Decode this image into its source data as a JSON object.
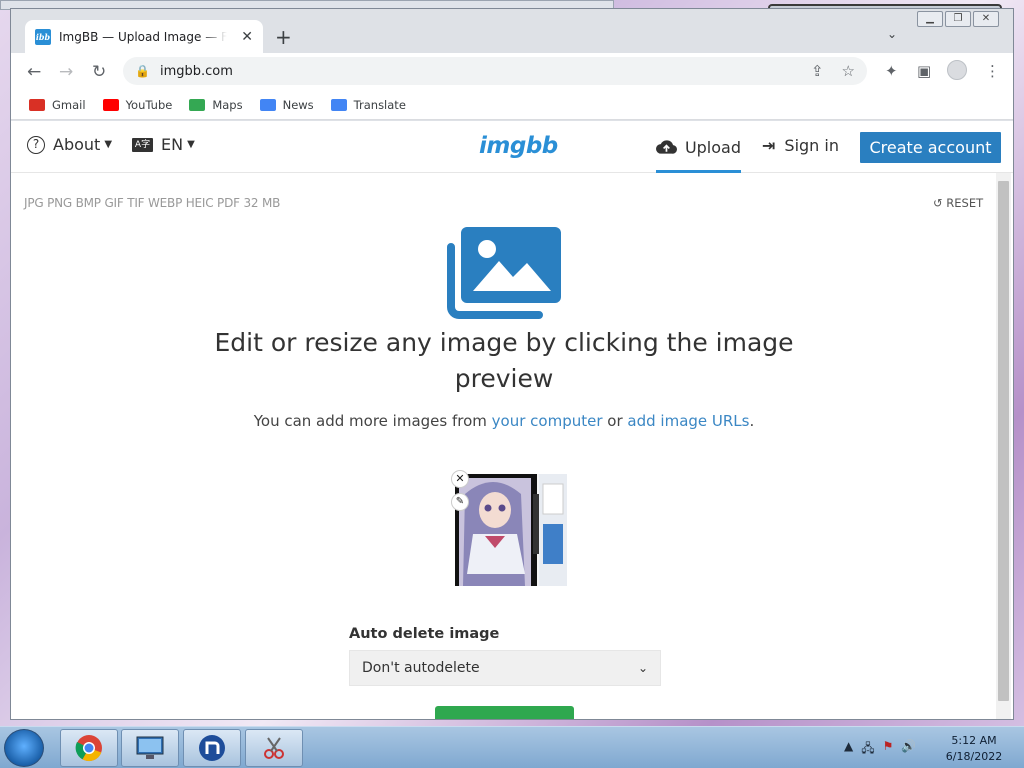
{
  "browser": {
    "tab_title": "ImgBB — Upload Image — Free Image Hosting",
    "url": "imgbb.com",
    "bookmarks": [
      {
        "label": "Gmail",
        "color": "#d93025"
      },
      {
        "label": "YouTube",
        "color": "#ff0000"
      },
      {
        "label": "Maps",
        "color": "#34a853"
      },
      {
        "label": "News",
        "color": "#4285f4"
      },
      {
        "label": "Translate",
        "color": "#4285f4"
      }
    ]
  },
  "site": {
    "about_label": "About",
    "lang_label": "EN",
    "lang_icon_text": "A字",
    "logo": "imgbb",
    "upload_label": "Upload",
    "signin_label": "Sign in",
    "create_account_label": "Create account",
    "accent_color": "#2a8fd6"
  },
  "uploader": {
    "formats": "JPG PNG BMP GIF TIF WEBP HEIC PDF   32 MB",
    "reset_label": "RESET",
    "headline": "Edit or resize any image by clicking the image preview",
    "sub_prefix": "You can add more images from ",
    "sub_link1": "your computer",
    "sub_mid": " or ",
    "sub_link2": "add image URLs",
    "sub_suffix": ".",
    "auto_delete_label": "Auto delete image",
    "auto_delete_value": "Don't autodelete"
  },
  "taskbar": {
    "time": "5:12 AM",
    "date": "6/18/2022"
  }
}
